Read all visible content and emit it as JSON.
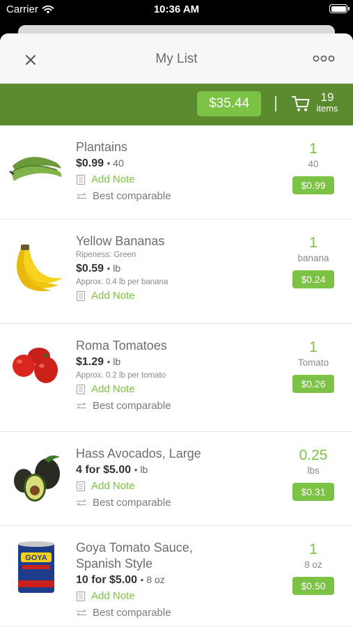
{
  "status": {
    "carrier": "Carrier",
    "time": "10:36 AM"
  },
  "header": {
    "title": "My List"
  },
  "summary": {
    "total": "$35.44",
    "item_count": "19",
    "items_label": "items"
  },
  "items": [
    {
      "name": "Plantains",
      "price": "$0.99",
      "unit": "40",
      "add_note": "Add Note",
      "comparable": "Best comparable",
      "qty": "1",
      "qty_unit": "40",
      "line_price": "$0.99"
    },
    {
      "name": "Yellow Bananas",
      "subnote": "Ripeness: Green",
      "price": "$0.59",
      "unit": "lb",
      "approx": "Approx. 0.4 lb per banana",
      "add_note": "Add Note",
      "qty": "1",
      "qty_unit": "banana",
      "line_price": "$0.24"
    },
    {
      "name": "Roma Tomatoes",
      "price": "$1.29",
      "unit": "lb",
      "approx": "Approx. 0.2 lb per tomato",
      "add_note": "Add Note",
      "comparable": "Best comparable",
      "qty": "1",
      "qty_unit": "Tomato",
      "line_price": "$0.26"
    },
    {
      "name": "Hass Avocados, Large",
      "price": "4 for $5.00",
      "unit": "lb",
      "add_note": "Add Note",
      "comparable": "Best comparable",
      "qty": "0.25",
      "qty_unit": "lbs",
      "line_price": "$0.31"
    },
    {
      "name_line1": "Goya Tomato Sauce,",
      "name_line2": "Spanish Style",
      "price": "10 for $5.00",
      "unit": "8 oz",
      "add_note": "Add Note",
      "comparable": "Best comparable",
      "qty": "1",
      "qty_unit": "8 oz",
      "line_price": "$0.50",
      "brand": "GOYA"
    }
  ],
  "icons": {
    "note": "note-icon",
    "compare": "compare-arrows-icon",
    "cart": "cart-icon",
    "close": "close-icon",
    "more": "more-icon"
  },
  "colors": {
    "accent": "#7cc244",
    "header_bar": "#5b8a2f"
  }
}
